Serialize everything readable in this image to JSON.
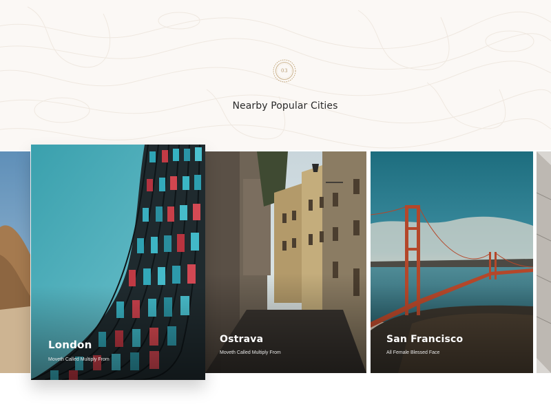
{
  "section": {
    "badge_number": "03",
    "title": "Nearby Popular Cities"
  },
  "cities": [
    {
      "name": "London",
      "description": "Moveth Called Multiply From"
    },
    {
      "name": "Ostrava",
      "description": "Moveth Called Multiply From"
    },
    {
      "name": "San Francisco",
      "description": "All Female Blessed Face"
    }
  ],
  "colors": {
    "hero_background": "#fbf8f5",
    "badge_gold": "#c2a67a",
    "title_text": "#2a2a2a",
    "card_text": "#ffffff"
  },
  "icons": {
    "badge": "ornamental-circle-icon"
  }
}
